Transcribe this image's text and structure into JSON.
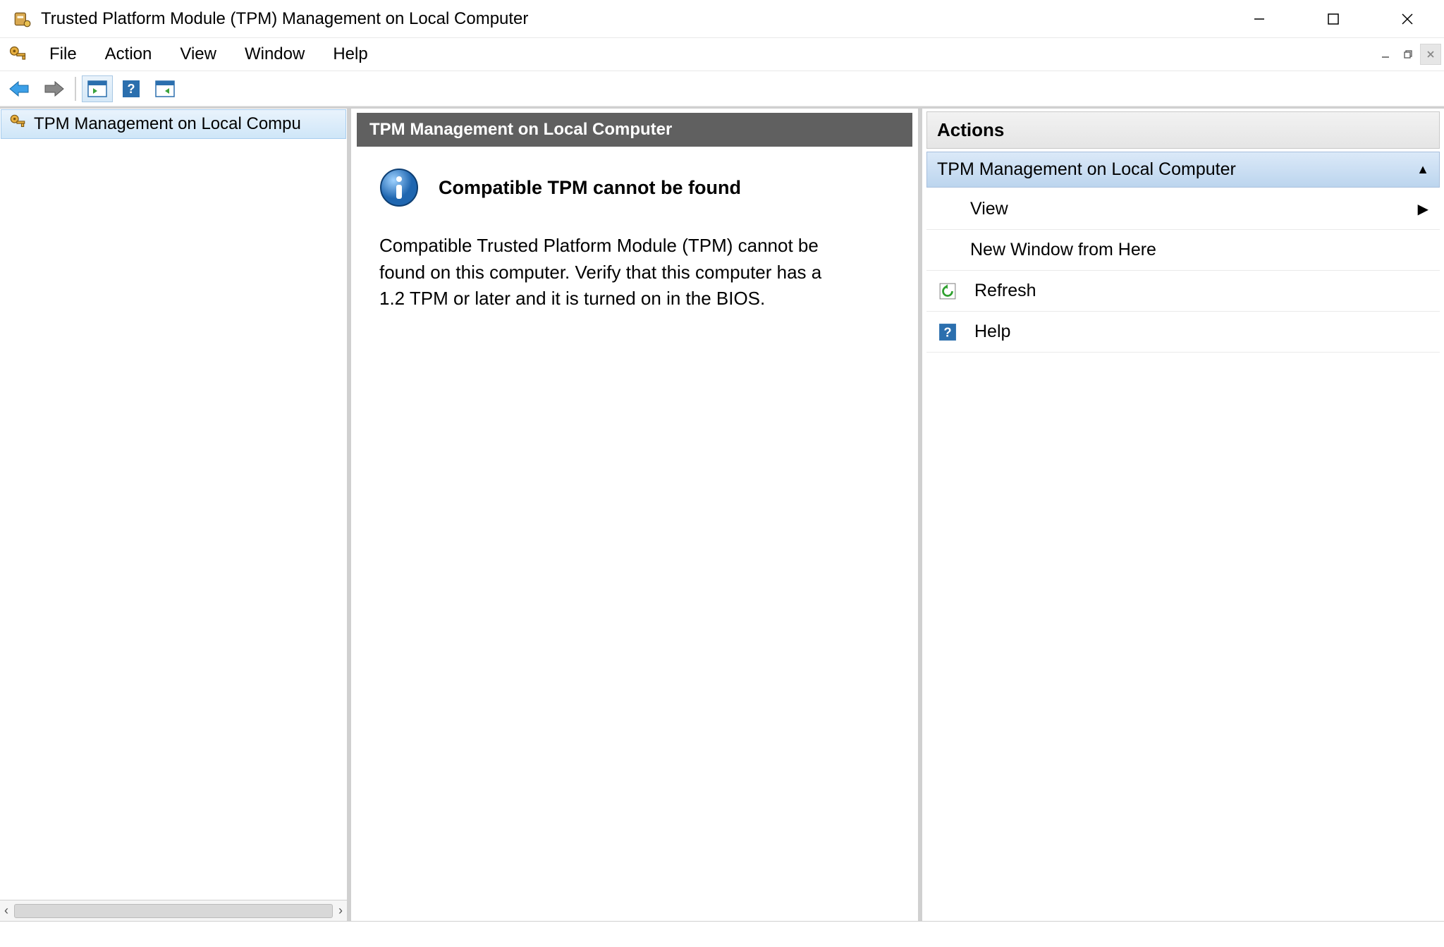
{
  "window": {
    "title": "Trusted Platform Module (TPM) Management on Local Computer"
  },
  "menu": {
    "items": [
      "File",
      "Action",
      "View",
      "Window",
      "Help"
    ]
  },
  "tree": {
    "root": "TPM Management on Local Compu"
  },
  "center": {
    "header": "TPM Management on Local Computer",
    "heading": "Compatible TPM cannot be found",
    "body": "Compatible Trusted Platform Module (TPM) cannot be found on this computer. Verify that this computer has a 1.2 TPM or later and it is turned on in the BIOS."
  },
  "actions": {
    "title": "Actions",
    "section": "TPM Management on Local Computer",
    "items": {
      "view": "View",
      "new_window": "New Window from Here",
      "refresh": "Refresh",
      "help": "Help"
    }
  }
}
